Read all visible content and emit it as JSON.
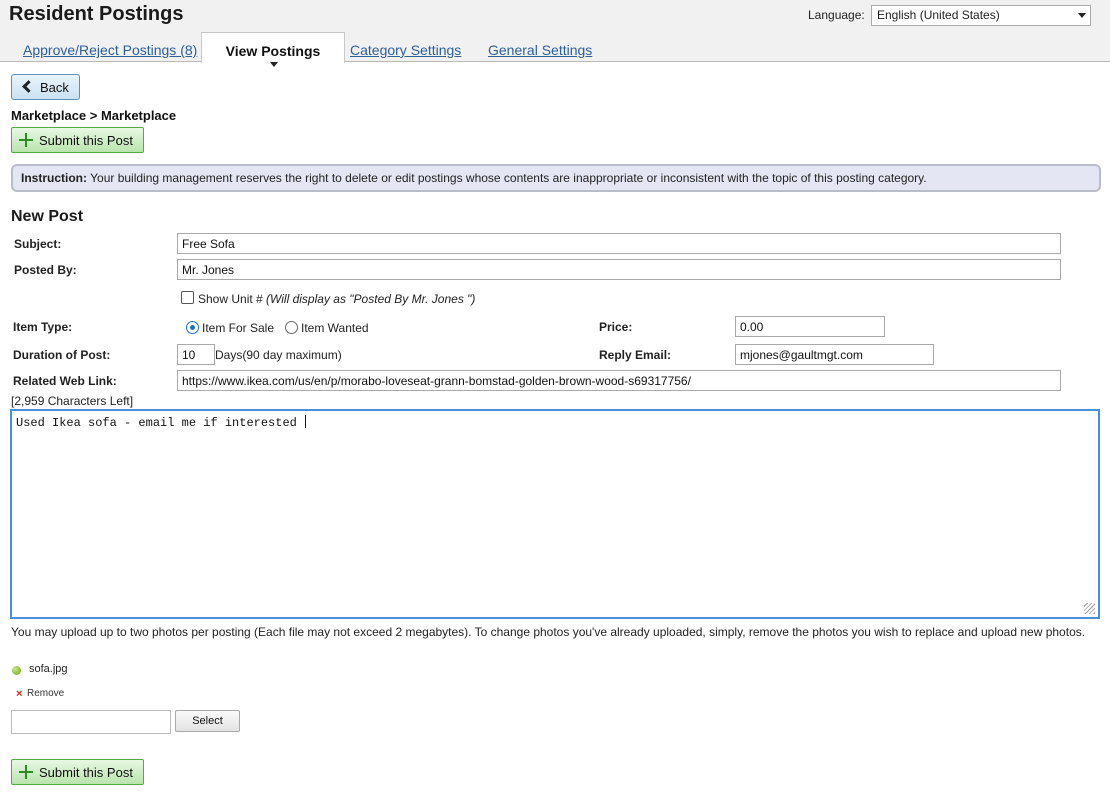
{
  "header": {
    "app_title": "Resident Postings",
    "language_label": "Language:",
    "language_value": "English (United States)"
  },
  "tabs": [
    {
      "label": "Approve/Reject Postings (8)",
      "active": false
    },
    {
      "label": "View Postings",
      "active": true
    },
    {
      "label": "Category Settings",
      "active": false
    },
    {
      "label": "General Settings",
      "active": false
    }
  ],
  "back_label": "Back",
  "breadcrumb": "Marketplace > Marketplace",
  "submit_label": "Submit this Post",
  "instruction": {
    "title": "Instruction:",
    "text": " Your building management reserves the right to delete or edit postings whose contents are inappropriate or inconsistent with the topic of this posting category."
  },
  "form": {
    "title": "New Post",
    "subject_label": "Subject:",
    "subject_value": "Free Sofa",
    "posted_by_label": "Posted By:",
    "posted_by_value": "Mr. Jones",
    "show_unit_label": "Show Unit #",
    "show_unit_note": "(Will display as \"Posted By  Mr. Jones \")",
    "show_unit_checked": false,
    "item_type_label": "Item Type:",
    "item_for_sale_label": "Item For Sale",
    "item_wanted_label": "Item Wanted",
    "item_type_selected": "Item For Sale",
    "price_label": "Price:",
    "price_value": "0.00",
    "duration_label": "Duration of Post:",
    "duration_value": "10",
    "duration_note": "Days(90 day maximum)",
    "reply_email_label": "Reply Email:",
    "reply_email_value": "mjones@gaultmgt.com",
    "web_link_label": "Related Web Link:",
    "web_link_value": "https://www.ikea.com/us/en/p/morabo-loveseat-grann-bomstad-golden-brown-wood-s69317756/",
    "chars_left": "[2,959 Characters Left]",
    "body_text": "Used Ikea sofa - email me if interested "
  },
  "upload": {
    "info": "You may upload up to two photos per posting (Each file may not exceed 2 megabytes). To change photos you've already uploaded, simply, remove the photos you wish to replace and upload new photos.",
    "file_name": "sofa.jpg",
    "remove_label": "Remove",
    "select_label": "Select"
  },
  "colors": {
    "link": "#2d5f9a",
    "back_button": "#c9e2f2",
    "submit_button": "#b9e4ad",
    "instruction_bg": "#e4e6f3",
    "textarea_focus": "#4a8fd8"
  }
}
